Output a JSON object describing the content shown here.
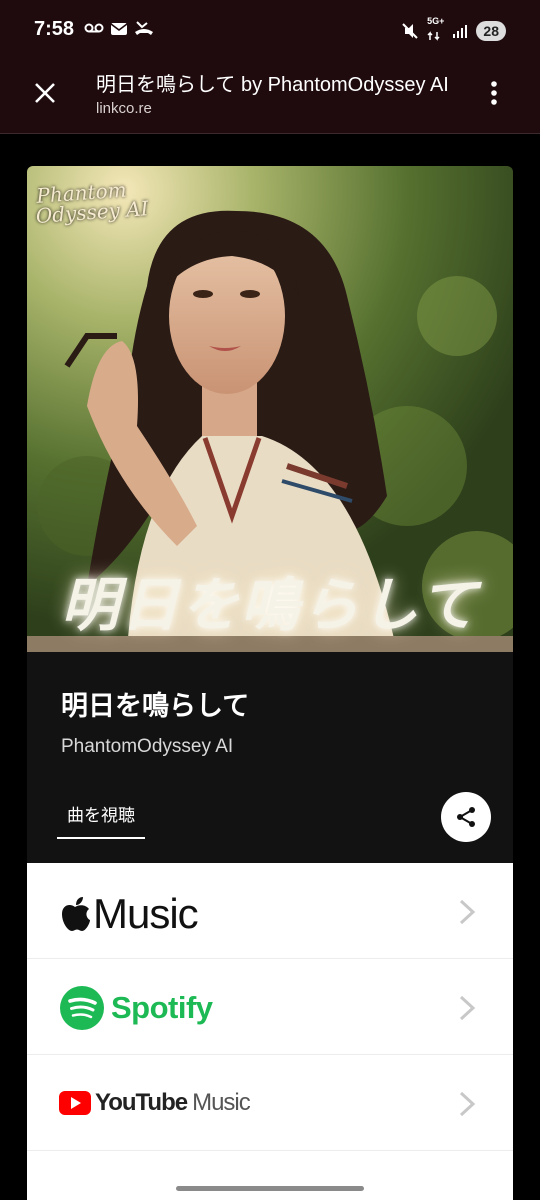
{
  "status_bar": {
    "time": "7:58",
    "network": "5G+",
    "battery": "28",
    "icons": [
      "voicemail-icon",
      "mail-icon",
      "missed-call-icon",
      "mute-icon",
      "data-arrows-icon",
      "signal-icon"
    ]
  },
  "browser": {
    "title": "明日を鳴らして by PhantomOdyssey AI",
    "url": "linkco.re",
    "close_icon": "close-icon",
    "menu_icon": "more-vert-icon"
  },
  "cover": {
    "logo_text_1": "Phantom",
    "logo_text_2": "Odyssey AI",
    "overlay_title": "明日を鳴らして"
  },
  "release": {
    "title": "明日を鳴らして",
    "artist": "PhantomOdyssey AI",
    "tab_label": "曲を視聴",
    "share_icon": "share-icon"
  },
  "services": [
    {
      "name": "Apple Music",
      "logo_text": "Music",
      "icon": "apple-icon"
    },
    {
      "name": "Spotify",
      "logo_text": "Spotify",
      "icon": "spotify-icon"
    },
    {
      "name": "YouTube Music",
      "logo_text_1": "YouTube",
      "logo_text_2": "Music",
      "icon": "youtube-icon"
    }
  ],
  "colors": {
    "header_bg": "#1f0b0e",
    "info_bg": "#121212",
    "spotify_green": "#1DB954",
    "youtube_red": "#FF0000"
  }
}
